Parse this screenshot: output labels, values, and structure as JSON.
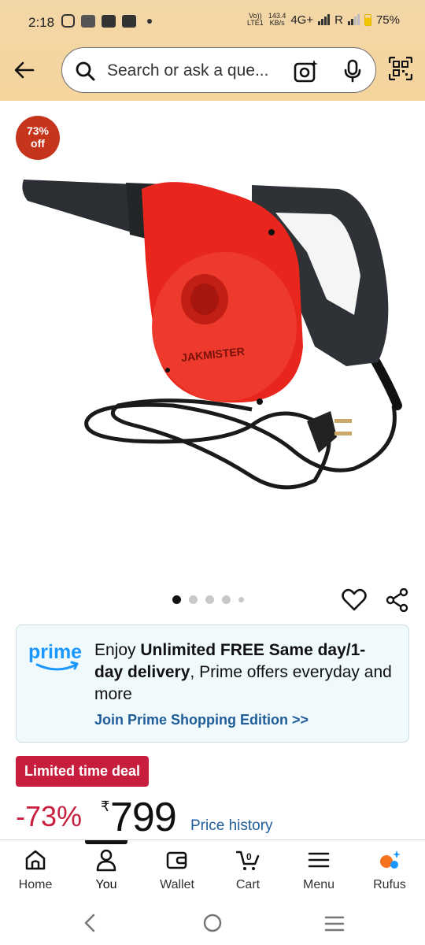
{
  "status_bar": {
    "time": "2:18",
    "net_speed_value": "143.4",
    "net_speed_unit": "KB/s",
    "volte_label": "Vo))",
    "lte_label": "LTE1",
    "network_type": "4G+",
    "roaming": "R",
    "battery": "75%"
  },
  "search": {
    "placeholder": "Search or ask a que..."
  },
  "product": {
    "discount_badge_percent": "73%",
    "discount_badge_off": "off",
    "image_brand_text": "JAKMISTER",
    "carousel_count": 5,
    "carousel_active": 0
  },
  "prime": {
    "logo_text": "prime",
    "line_pre": "Enjoy ",
    "line_bold": "Unlimited FREE Same day/1-day delivery",
    "line_post": ", Prime offers everyday and more",
    "link": "Join Prime Shopping Edition >>"
  },
  "deal": {
    "badge": "Limited time deal",
    "discount": "-73%",
    "currency": "₹",
    "price": "799",
    "price_history_link": "Price history"
  },
  "bottom_nav": {
    "items": [
      {
        "label": "Home",
        "icon": "home-icon"
      },
      {
        "label": "You",
        "icon": "person-icon"
      },
      {
        "label": "Wallet",
        "icon": "wallet-icon"
      },
      {
        "label": "Cart",
        "icon": "cart-icon",
        "badge": "0"
      },
      {
        "label": "Menu",
        "icon": "menu-icon"
      },
      {
        "label": "Rufus",
        "icon": "rufus-icon"
      }
    ],
    "active_index": 1
  },
  "colors": {
    "header_bg": "#f5d49d",
    "deal_red": "#c81e3d",
    "link_blue": "#1f5d99",
    "badge_red": "#c7341c",
    "prime_blue": "#1a98ff"
  }
}
